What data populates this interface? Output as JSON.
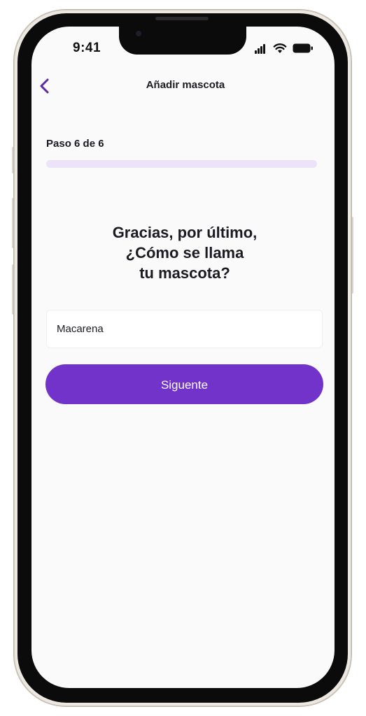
{
  "status_bar": {
    "time": "9:41",
    "icons": [
      "signal-icon",
      "wifi-icon",
      "battery-icon"
    ]
  },
  "header": {
    "back_icon": "chevron-left-icon",
    "title": "Añadir mascota"
  },
  "step": {
    "label": "Paso 6  de 6",
    "current": 6,
    "total": 6,
    "progress_fraction": 1.0
  },
  "question": {
    "line1": "Gracias, por último,",
    "line2": "¿Cómo se llama",
    "line3": "tu mascota?"
  },
  "pet_name_input": {
    "value": "Macarena",
    "placeholder": ""
  },
  "next_button": {
    "label": "Siguente"
  },
  "colors": {
    "accent": "#7133c9",
    "progress": "#ece3fb",
    "text": "#1b1b22",
    "screen_background": "#fafafa"
  }
}
